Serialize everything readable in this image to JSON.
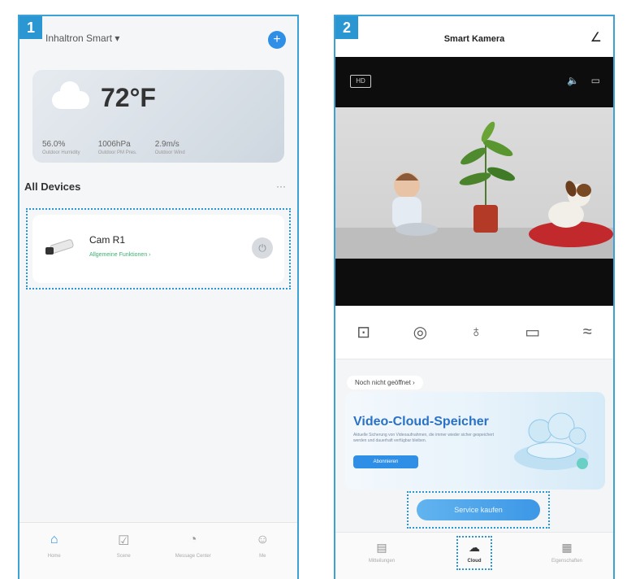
{
  "colors": {
    "accent": "#2a97d2",
    "brand_blue": "#2f8fe6",
    "online_green": "#3cb371"
  },
  "panel1": {
    "badge": "1",
    "home_title": "Inhaltron Smart ▾",
    "weather": {
      "temperature": "72°F",
      "stats": [
        {
          "value": "56.0%",
          "label": "Outdoor Humidity"
        },
        {
          "value": "1006hPa",
          "label": "Outdoor PM Pres."
        },
        {
          "value": "2.9m/s",
          "label": "Outdoor Wind"
        }
      ]
    },
    "section_title": "All Devices",
    "section_more": "···",
    "device": {
      "name": "Cam R1",
      "subtitle": "Allgemeine Funktionen ›",
      "icon": "camera-icon"
    },
    "tabs": [
      {
        "label": "Home",
        "icon": "home-icon"
      },
      {
        "label": "Scene",
        "icon": "scene-icon"
      },
      {
        "label": "Message Center",
        "icon": "message-icon"
      },
      {
        "label": "Me",
        "icon": "profile-icon"
      }
    ]
  },
  "panel2": {
    "badge": "2",
    "title": "Smart Kamera",
    "hd_label": "HD",
    "controls": [
      "screenshot-icon",
      "camera-icon",
      "microphone-icon",
      "record-icon",
      "more-icon"
    ],
    "promo_label": "Noch nicht geöffnet ›",
    "promo_title": "Video-Cloud-Speicher",
    "promo_desc": "Aktuelle Sicherung von Videoaufnahmen, die immer wieder sicher gespeichert werden und dauerhaft verfügbar bleiben.",
    "promo_button": "Abonnieren",
    "service_button": "Service kaufen",
    "tabs": [
      {
        "label": "Mitteilungen",
        "icon": "message-icon"
      },
      {
        "label": "Cloud",
        "icon": "cloud-icon"
      },
      {
        "label": "Eigenschaften",
        "icon": "grid-icon"
      }
    ]
  }
}
